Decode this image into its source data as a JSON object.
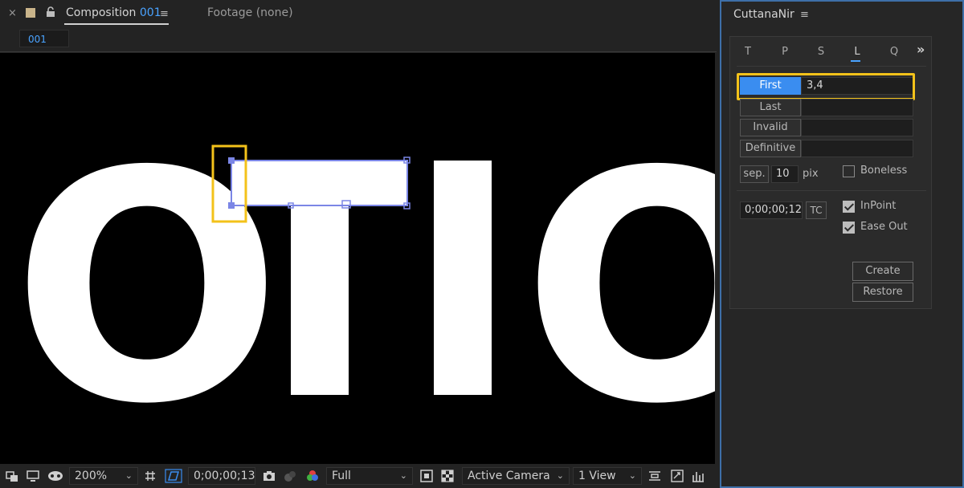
{
  "composition_panel": {
    "tab": {
      "close": "×",
      "title_prefix": "Composition",
      "title_number": "001",
      "menu": "≡"
    },
    "footage_tab": "Footage  (none)",
    "breadcrumb": "001",
    "viewer_text": "OTIO"
  },
  "viewer_toolbar": {
    "zoom": "200%",
    "timecode": "0;00;00;13",
    "resolution": "Full",
    "camera": "Active Camera",
    "views": "1 View"
  },
  "side_panel": {
    "title": "CuttanaNir",
    "menu": "≡",
    "tabs": [
      "T",
      "P",
      "S",
      "L",
      "Q"
    ],
    "active_tab": "L",
    "more": "»",
    "rows": [
      {
        "label": "First",
        "value": "3,4",
        "active": true
      },
      {
        "label": "Last",
        "value": ""
      },
      {
        "label": "Invalid",
        "value": ""
      },
      {
        "label": "Definitive",
        "value": ""
      }
    ],
    "sep_label": "sep.",
    "sep_value": "10",
    "sep_unit": "pix",
    "boneless_label": "Boneless",
    "boneless_checked": false,
    "timecode_value": "0;00;00;12",
    "tc_label": "TC",
    "inpoint_label": "InPoint",
    "inpoint_checked": true,
    "easeout_label": "Ease Out",
    "easeout_checked": true,
    "create_label": "Create",
    "restore_label": "Restore"
  },
  "colors": {
    "accent_blue": "#3a8df0",
    "highlight_yellow": "#f3c21a",
    "selection_outline": "#7b86e6",
    "panel_border": "#3e6fa8"
  }
}
